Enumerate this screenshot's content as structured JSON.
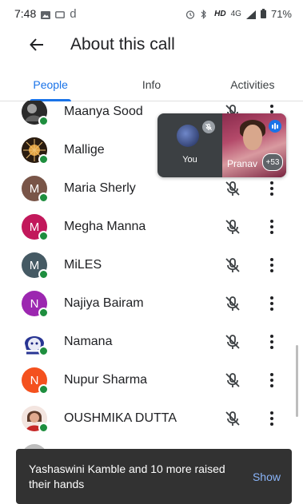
{
  "status_bar": {
    "time": "7:48",
    "carrier_letter": "d",
    "network": "HD",
    "network_type": "4G",
    "battery": "71%"
  },
  "app_bar": {
    "title": "About this call",
    "back_icon": "arrow-back-icon"
  },
  "tabs": [
    {
      "label": "People",
      "active": true
    },
    {
      "label": "Info",
      "active": false
    },
    {
      "label": "Activities",
      "active": false
    }
  ],
  "participants": [
    {
      "name": "Maanya Sood",
      "initial": "",
      "avatar_color": "#2b2b2b",
      "muted": true
    },
    {
      "name": "Mallige",
      "initial": "",
      "avatar_color": "#4a3a2a",
      "muted": true
    },
    {
      "name": "Maria Sherly",
      "initial": "M",
      "avatar_color": "#795548",
      "muted": true
    },
    {
      "name": "Megha Manna",
      "initial": "M",
      "avatar_color": "#c2185b",
      "muted": true
    },
    {
      "name": "MiLES",
      "initial": "M",
      "avatar_color": "#455a64",
      "muted": true
    },
    {
      "name": "Najiya Bairam",
      "initial": "N",
      "avatar_color": "#9c27b0",
      "muted": true
    },
    {
      "name": "Namana",
      "initial": "",
      "avatar_color": "#3949ab",
      "muted": true
    },
    {
      "name": "Nupur Sharma",
      "initial": "N",
      "avatar_color": "#f4511e",
      "muted": true
    },
    {
      "name": "OUSHMIKA DUTTA",
      "initial": "",
      "avatar_color": "#c9877a",
      "muted": true
    }
  ],
  "pip": {
    "you_label": "You",
    "other_name": "Pranav",
    "others_count": "+53"
  },
  "snackbar": {
    "message": "Yashaswini Kamble and 10 more raised their hands",
    "action": "Show"
  },
  "colors": {
    "accent": "#1a73e8",
    "online": "#1e8e3e",
    "snackbar_bg": "#323232",
    "snackbar_action": "#8ab4f8"
  }
}
